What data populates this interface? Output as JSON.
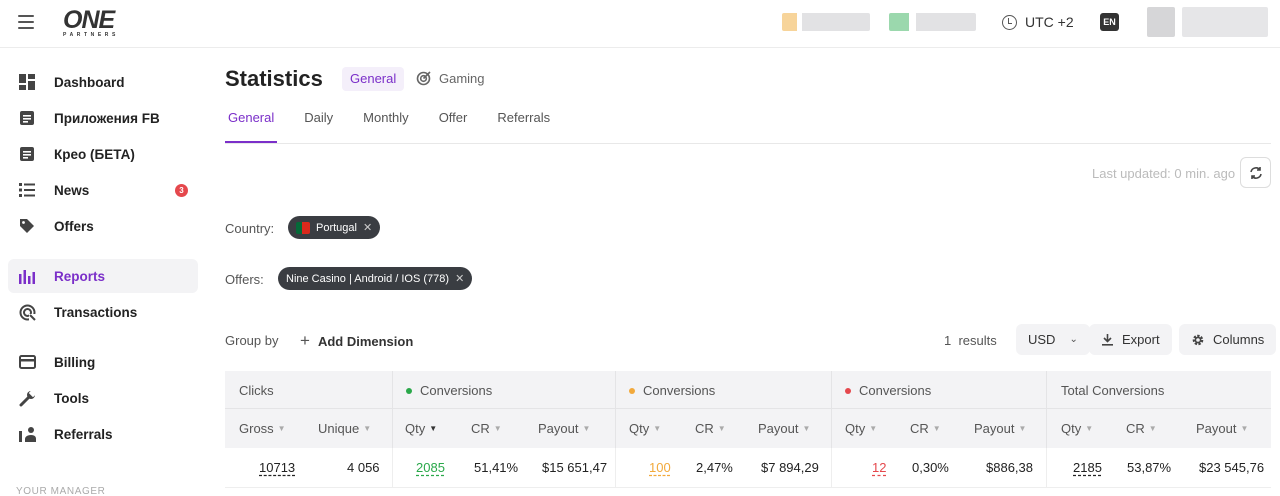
{
  "header": {
    "logo_main": "ONE",
    "logo_sub": "PARTNERS",
    "timezone": "UTC +2",
    "language": "EN"
  },
  "sidebar": {
    "items": [
      {
        "label": "Dashboard",
        "icon": "dashboard-icon"
      },
      {
        "label": "Приложения FB",
        "icon": "document-icon"
      },
      {
        "label": "Крео (БЕТА)",
        "icon": "document-icon"
      },
      {
        "label": "News",
        "icon": "news-icon",
        "badge": "3"
      },
      {
        "label": "Offers",
        "icon": "tag-icon"
      },
      {
        "label": "Reports",
        "icon": "bar-chart-icon",
        "active": true
      },
      {
        "label": "Transactions",
        "icon": "transactions-icon"
      },
      {
        "label": "Billing",
        "icon": "card-icon"
      },
      {
        "label": "Tools",
        "icon": "wrench-icon"
      },
      {
        "label": "Referrals",
        "icon": "referrals-icon"
      }
    ],
    "footer_label": "YOUR MANAGER"
  },
  "page": {
    "title": "Statistics",
    "mode_general": "General",
    "mode_gaming": "Gaming",
    "tabs": [
      "General",
      "Daily",
      "Monthly",
      "Offer",
      "Referrals"
    ],
    "last_updated": "Last updated: 0 min. ago"
  },
  "filters": {
    "country_label": "Country:",
    "country_value": "Portugal",
    "offers_label": "Offers:",
    "offers_value": "Nine Casino | Android / IOS (778)"
  },
  "toolbar": {
    "group_by": "Group by",
    "add_dimension": "Add Dimension",
    "results_count": "1",
    "results_label": "results",
    "currency": "USD",
    "export": "Export",
    "columns": "Columns"
  },
  "table": {
    "groups": {
      "clicks": "Clicks",
      "conv_green": "Conversions",
      "conv_yellow": "Conversions",
      "conv_red": "Conversions",
      "total": "Total Conversions"
    },
    "columns": {
      "gross": "Gross",
      "unique": "Unique",
      "qty": "Qty",
      "cr": "CR",
      "payout": "Payout"
    },
    "row": {
      "gross": "10713",
      "unique": "4 056",
      "g_qty": "2085",
      "g_cr": "51,41%",
      "g_payout": "$15 651,47",
      "y_qty": "100",
      "y_cr": "2,47%",
      "y_payout": "$7 894,29",
      "r_qty": "12",
      "r_cr": "0,30%",
      "r_payout": "$886,38",
      "t_qty": "2185",
      "t_cr": "53,87%",
      "t_payout": "$23 545,76"
    },
    "colors": {
      "green": "#2aa84a",
      "yellow": "#f2a93b",
      "red": "#e5484d",
      "accent": "#7b2fc9"
    }
  }
}
